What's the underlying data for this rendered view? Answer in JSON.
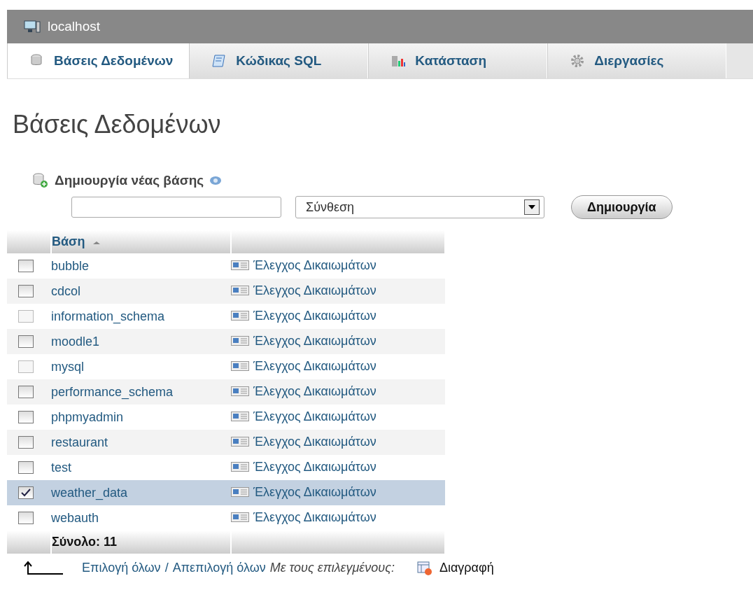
{
  "server": {
    "title": "localhost"
  },
  "tabs": [
    {
      "label": "Βάσεις Δεδομένων",
      "selected": true
    },
    {
      "label": "Κώδικας SQL",
      "selected": false
    },
    {
      "label": "Κατάσταση",
      "selected": false
    },
    {
      "label": "Διεργασίες",
      "selected": false
    }
  ],
  "heading": "Βάσεις Δεδομένων",
  "create": {
    "label": "Δημιουργία νέας βάσης",
    "collation": "Σύνθεση",
    "button": "Δημιουργία"
  },
  "table": {
    "columns": [
      {
        "label": "Βάση",
        "sorted": true
      },
      {}
    ],
    "rows": [
      {
        "name": "bubble",
        "privileges": "Έλεγχος Δικαιωμάτων",
        "checked": false,
        "disabled": false
      },
      {
        "name": "cdcol",
        "privileges": "Έλεγχος Δικαιωμάτων",
        "checked": false,
        "disabled": false
      },
      {
        "name": "information_schema",
        "privileges": "Έλεγχος Δικαιωμάτων",
        "checked": false,
        "disabled": true
      },
      {
        "name": "moodle1",
        "privileges": "Έλεγχος Δικαιωμάτων",
        "checked": false,
        "disabled": false
      },
      {
        "name": "mysql",
        "privileges": "Έλεγχος Δικαιωμάτων",
        "checked": false,
        "disabled": true
      },
      {
        "name": "performance_schema",
        "privileges": "Έλεγχος Δικαιωμάτων",
        "checked": false,
        "disabled": false
      },
      {
        "name": "phpmyadmin",
        "privileges": "Έλεγχος Δικαιωμάτων",
        "checked": false,
        "disabled": false
      },
      {
        "name": "restaurant",
        "privileges": "Έλεγχος Δικαιωμάτων",
        "checked": false,
        "disabled": false
      },
      {
        "name": "test",
        "privileges": "Έλεγχος Δικαιωμάτων",
        "checked": false,
        "disabled": false
      },
      {
        "name": "weather_data",
        "privileges": "Έλεγχος Δικαιωμάτων",
        "checked": true,
        "disabled": false
      },
      {
        "name": "webauth",
        "privileges": "Έλεγχος Δικαιωμάτων",
        "checked": false,
        "disabled": false
      }
    ],
    "total": "Σύνολο: 11"
  },
  "footer": {
    "select_all": "Επιλογή όλων",
    "separator": "/",
    "deselect_all": "Απεπιλογή όλων",
    "with_selected": "Με τους επιλεγμένους:",
    "action": "Διαγραφή"
  }
}
